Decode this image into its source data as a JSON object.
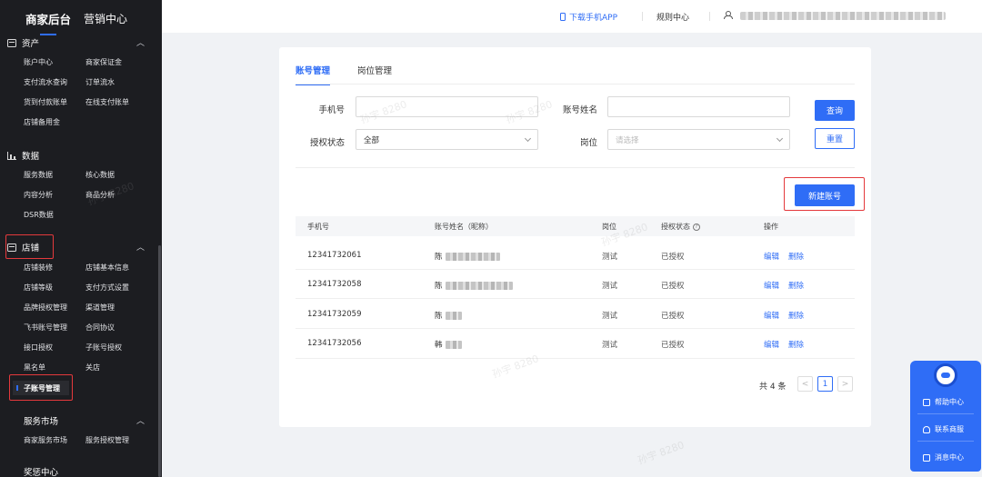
{
  "sidebar": {
    "top_tabs": [
      "商家后台",
      "营销中心"
    ],
    "groups": [
      {
        "key": "assets",
        "label": "资产",
        "items": [
          "账户中心",
          "商家保证金",
          "支付流水查询",
          "订单流水",
          "货到付款账单",
          "在线支付账单",
          "店铺备用金"
        ]
      },
      {
        "key": "data",
        "label": "数据",
        "items": [
          "服务数据",
          "核心数据",
          "内容分析",
          "商品分析",
          "DSR数据"
        ]
      },
      {
        "key": "store",
        "label": "店铺",
        "items": [
          "店铺装修",
          "店铺基本信息",
          "店铺等级",
          "支付方式设置",
          "品牌授权管理",
          "渠道管理",
          "飞书账号管理",
          "合同协议",
          "接口授权",
          "子账号授权",
          "黑名单",
          "关店",
          "子账号管理"
        ]
      },
      {
        "key": "market",
        "label": "服务市场",
        "items": [
          "商家服务市场",
          "服务授权管理"
        ]
      },
      {
        "key": "rewards",
        "label": "奖惩中心",
        "items": []
      }
    ]
  },
  "header": {
    "download_app": "下载手机APP",
    "rules": "规则中心"
  },
  "tabs": [
    {
      "label": "账号管理",
      "active": true
    },
    {
      "label": "岗位管理",
      "active": false
    }
  ],
  "filters": {
    "phone_label": "手机号",
    "phone_value": "",
    "name_label": "账号姓名",
    "name_value": "",
    "auth_label": "授权状态",
    "auth_value": "全部",
    "role_label": "岗位",
    "role_placeholder": "请选择",
    "query_button": "查询",
    "reset_button": "重置"
  },
  "new_account_button": "新建账号",
  "table": {
    "columns": [
      "手机号",
      "账号姓名（昵称）",
      "岗位",
      "授权状态",
      "操作"
    ],
    "rows": [
      {
        "phone": "12341732061",
        "name": "陈",
        "role": "测试",
        "status": "已授权"
      },
      {
        "phone": "12341732058",
        "name": "陈",
        "role": "测试",
        "status": "已授权"
      },
      {
        "phone": "12341732059",
        "name": "陈",
        "role": "测试",
        "status": "已授权"
      },
      {
        "phone": "12341732056",
        "name": "韩",
        "role": "测试",
        "status": "已授权"
      }
    ],
    "actions": {
      "edit": "编辑",
      "delete": "删除"
    }
  },
  "pagination": {
    "total": "共 4 条",
    "prev": "<",
    "current": "1",
    "next": ">"
  },
  "watermark": "孙宇 8280",
  "help_panel": {
    "items": [
      "帮助中心",
      "联系商服",
      "消息中心"
    ]
  },
  "colors": {
    "accent": "#2f6df6",
    "highlight": "#e4393c",
    "sidebar_bg": "#1c1d21"
  }
}
